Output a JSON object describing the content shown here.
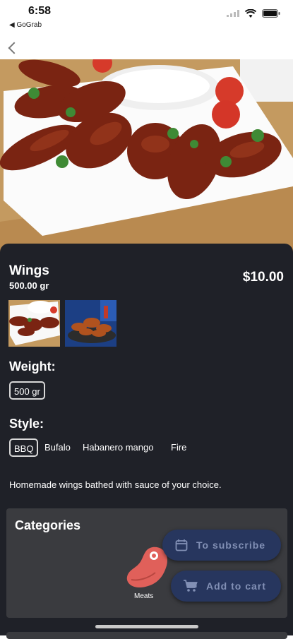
{
  "status_bar": {
    "time": "6:58",
    "back_app": "◀ GoGrab"
  },
  "product": {
    "name": "Wings",
    "weight_label": "500.00 gr",
    "price": "$10.00",
    "description": "Homemade wings bathed with sauce of your choice."
  },
  "weight_section": {
    "title": "Weight:",
    "options": [
      "500 gr"
    ],
    "selected": "500 gr"
  },
  "style_section": {
    "title": "Style:",
    "options": [
      "BBQ",
      "Bufalo",
      "Habanero mango",
      "Fire"
    ],
    "selected": "BBQ"
  },
  "categories": {
    "title": "Categories",
    "items": [
      {
        "label": "Meats",
        "icon": "meat-icon"
      }
    ]
  },
  "actions": {
    "subscribe_label": "To subscribe",
    "cart_label": "Add to cart"
  },
  "colors": {
    "panel_bg": "#1f2128",
    "fab_bg": "#27365e",
    "fab_text": "#8290b5",
    "meat_icon": "#e0605a"
  }
}
